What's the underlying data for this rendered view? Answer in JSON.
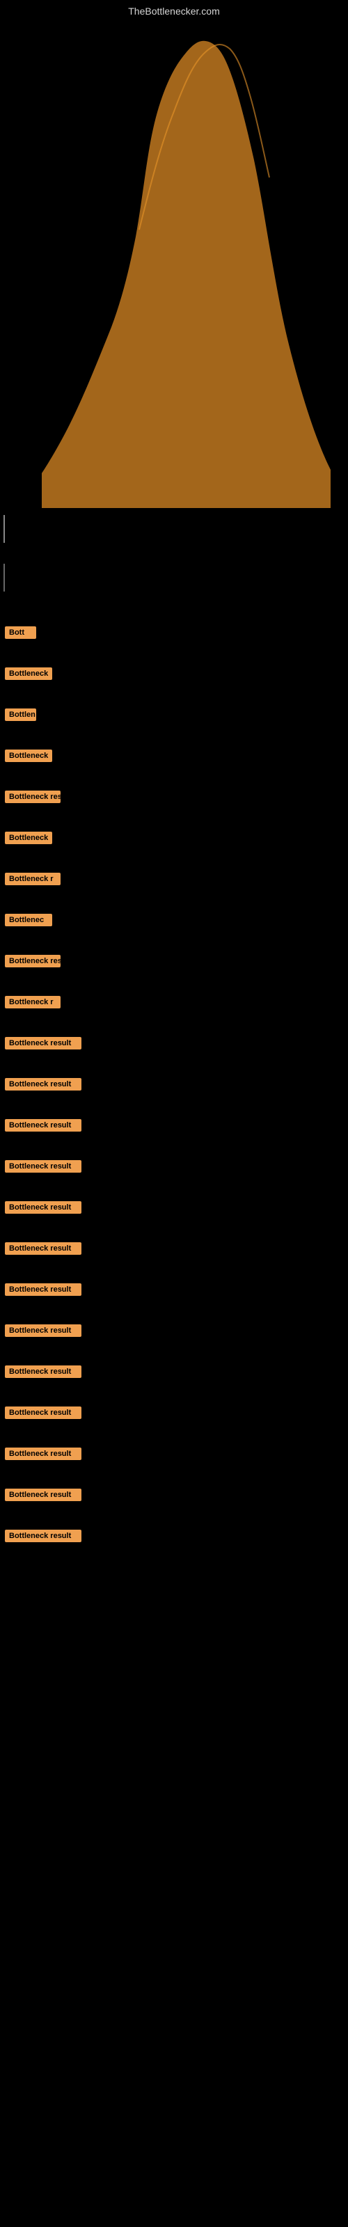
{
  "site": {
    "title": "TheBottlenecker.com"
  },
  "bottleneck_rows": [
    {
      "id": 1,
      "label": "Bott",
      "width_class": "w-tiny"
    },
    {
      "id": 2,
      "label": "Bottleneck",
      "width_class": "w-small"
    },
    {
      "id": 3,
      "label": "Bottlen",
      "width_class": "w-tiny"
    },
    {
      "id": 4,
      "label": "Bottleneck",
      "width_class": "w-small"
    },
    {
      "id": 5,
      "label": "Bottleneck res",
      "width_class": "w-medium"
    },
    {
      "id": 6,
      "label": "Bottleneck",
      "width_class": "w-small"
    },
    {
      "id": 7,
      "label": "Bottleneck r",
      "width_class": "w-medium"
    },
    {
      "id": 8,
      "label": "Bottlenec",
      "width_class": "w-small"
    },
    {
      "id": 9,
      "label": "Bottleneck resu",
      "width_class": "w-medium"
    },
    {
      "id": 10,
      "label": "Bottleneck r",
      "width_class": "w-medium"
    },
    {
      "id": 11,
      "label": "Bottleneck result",
      "width_class": "w-full"
    },
    {
      "id": 12,
      "label": "Bottleneck result",
      "width_class": "w-full"
    },
    {
      "id": 13,
      "label": "Bottleneck result",
      "width_class": "w-full"
    },
    {
      "id": 14,
      "label": "Bottleneck result",
      "width_class": "w-full"
    },
    {
      "id": 15,
      "label": "Bottleneck result",
      "width_class": "w-full"
    },
    {
      "id": 16,
      "label": "Bottleneck result",
      "width_class": "w-full"
    },
    {
      "id": 17,
      "label": "Bottleneck result",
      "width_class": "w-full"
    },
    {
      "id": 18,
      "label": "Bottleneck result",
      "width_class": "w-full"
    },
    {
      "id": 19,
      "label": "Bottleneck result",
      "width_class": "w-full"
    },
    {
      "id": 20,
      "label": "Bottleneck result",
      "width_class": "w-full"
    },
    {
      "id": 21,
      "label": "Bottleneck result",
      "width_class": "w-full"
    },
    {
      "id": 22,
      "label": "Bottleneck result",
      "width_class": "w-full"
    },
    {
      "id": 23,
      "label": "Bottleneck result",
      "width_class": "w-full"
    }
  ]
}
